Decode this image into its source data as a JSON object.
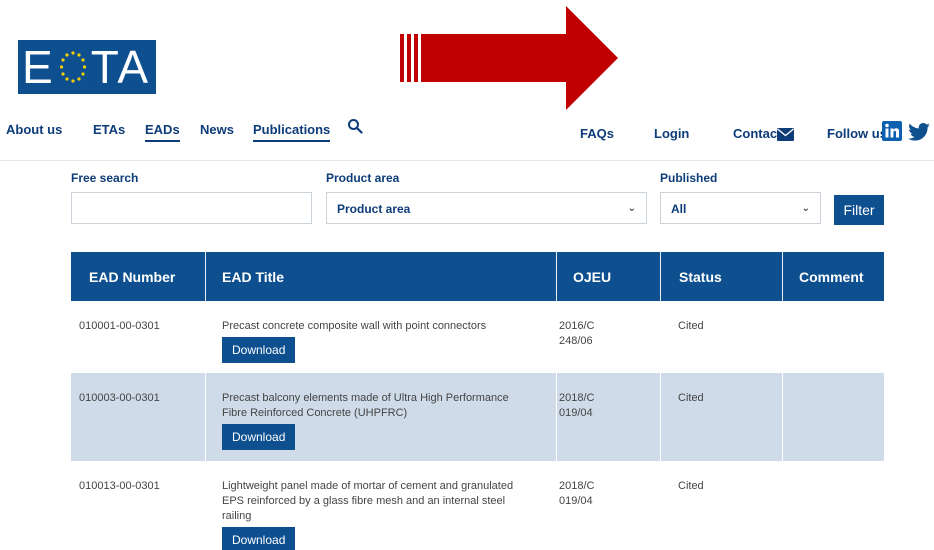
{
  "brand": {
    "logo_text_left": "E",
    "logo_text_right": "TA",
    "brand_color": "#0d4f8f",
    "arrow_color": "#c00000"
  },
  "nav": {
    "about": "About us",
    "etas": "ETAs",
    "eads": "EADs",
    "news": "News",
    "publications": "Publications",
    "faqs": "FAQs",
    "login": "Login",
    "contact": "Contact",
    "follow": "Follow us",
    "icons": [
      "search-icon",
      "envelope-icon",
      "linkedin-icon",
      "twitter-icon"
    ]
  },
  "filters": {
    "free_search_label": "Free search",
    "free_search_value": "",
    "product_area_label": "Product area",
    "product_area_value": "Product area",
    "published_label": "Published",
    "published_value": "All",
    "filter_button": "Filter"
  },
  "table": {
    "columns": [
      "EAD Number",
      "EAD Title",
      "OJEU",
      "Status",
      "Comment"
    ],
    "download_label": "Download",
    "rows": [
      {
        "number": "010001-00-0301",
        "title": "Precast concrete composite wall with point connectors",
        "ojeu": "2016/C\n248/06",
        "status": "Cited",
        "comment": ""
      },
      {
        "number": "010003-00-0301",
        "title": "Precast balcony elements made of Ultra High Performance Fibre Reinforced Concrete (UHPFRC)",
        "ojeu": "2018/C\n019/04",
        "status": "Cited",
        "comment": ""
      },
      {
        "number": "010013-00-0301",
        "title": "Lightweight panel made of mortar of cement and granulated EPS reinforced by a glass fibre mesh and an internal steel railing",
        "ojeu": "2018/C\n019/04",
        "status": "Cited",
        "comment": ""
      }
    ]
  }
}
